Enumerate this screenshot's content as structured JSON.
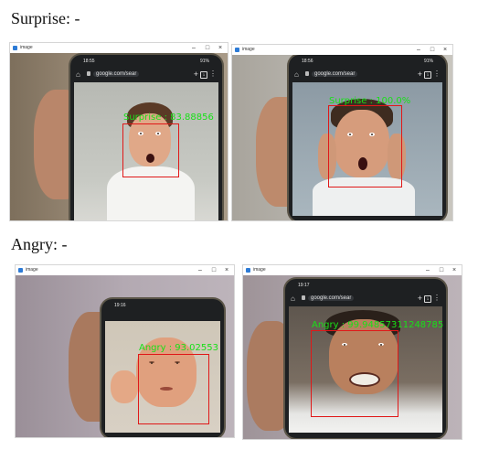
{
  "sections": {
    "surprise_heading": "Surprise: -",
    "angry_heading": "Angry: -"
  },
  "window": {
    "title": "image",
    "minimize_glyph": "–",
    "maximize_glyph": "□",
    "close_glyph": "×"
  },
  "phone_ui": {
    "url": "google.com/sear",
    "plus_glyph": "+",
    "tabs_count": "1",
    "more_glyph": "⋮",
    "home_glyph": "⌂"
  },
  "windows": [
    {
      "status_time": "18:55",
      "status_battery": "91%",
      "label": "Surprise : 83.88856"
    },
    {
      "status_time": "18:56",
      "status_battery": "91%",
      "label": "Surprise : 100.0%"
    },
    {
      "status_time": "19:16",
      "status_battery": "",
      "label": "Angry : 93.02553"
    },
    {
      "status_time": "19:17",
      "status_battery": "",
      "label": "Angry : 99.94857311248785"
    }
  ],
  "colors": {
    "detection_box": "#e01818",
    "detection_label": "#18e018"
  }
}
